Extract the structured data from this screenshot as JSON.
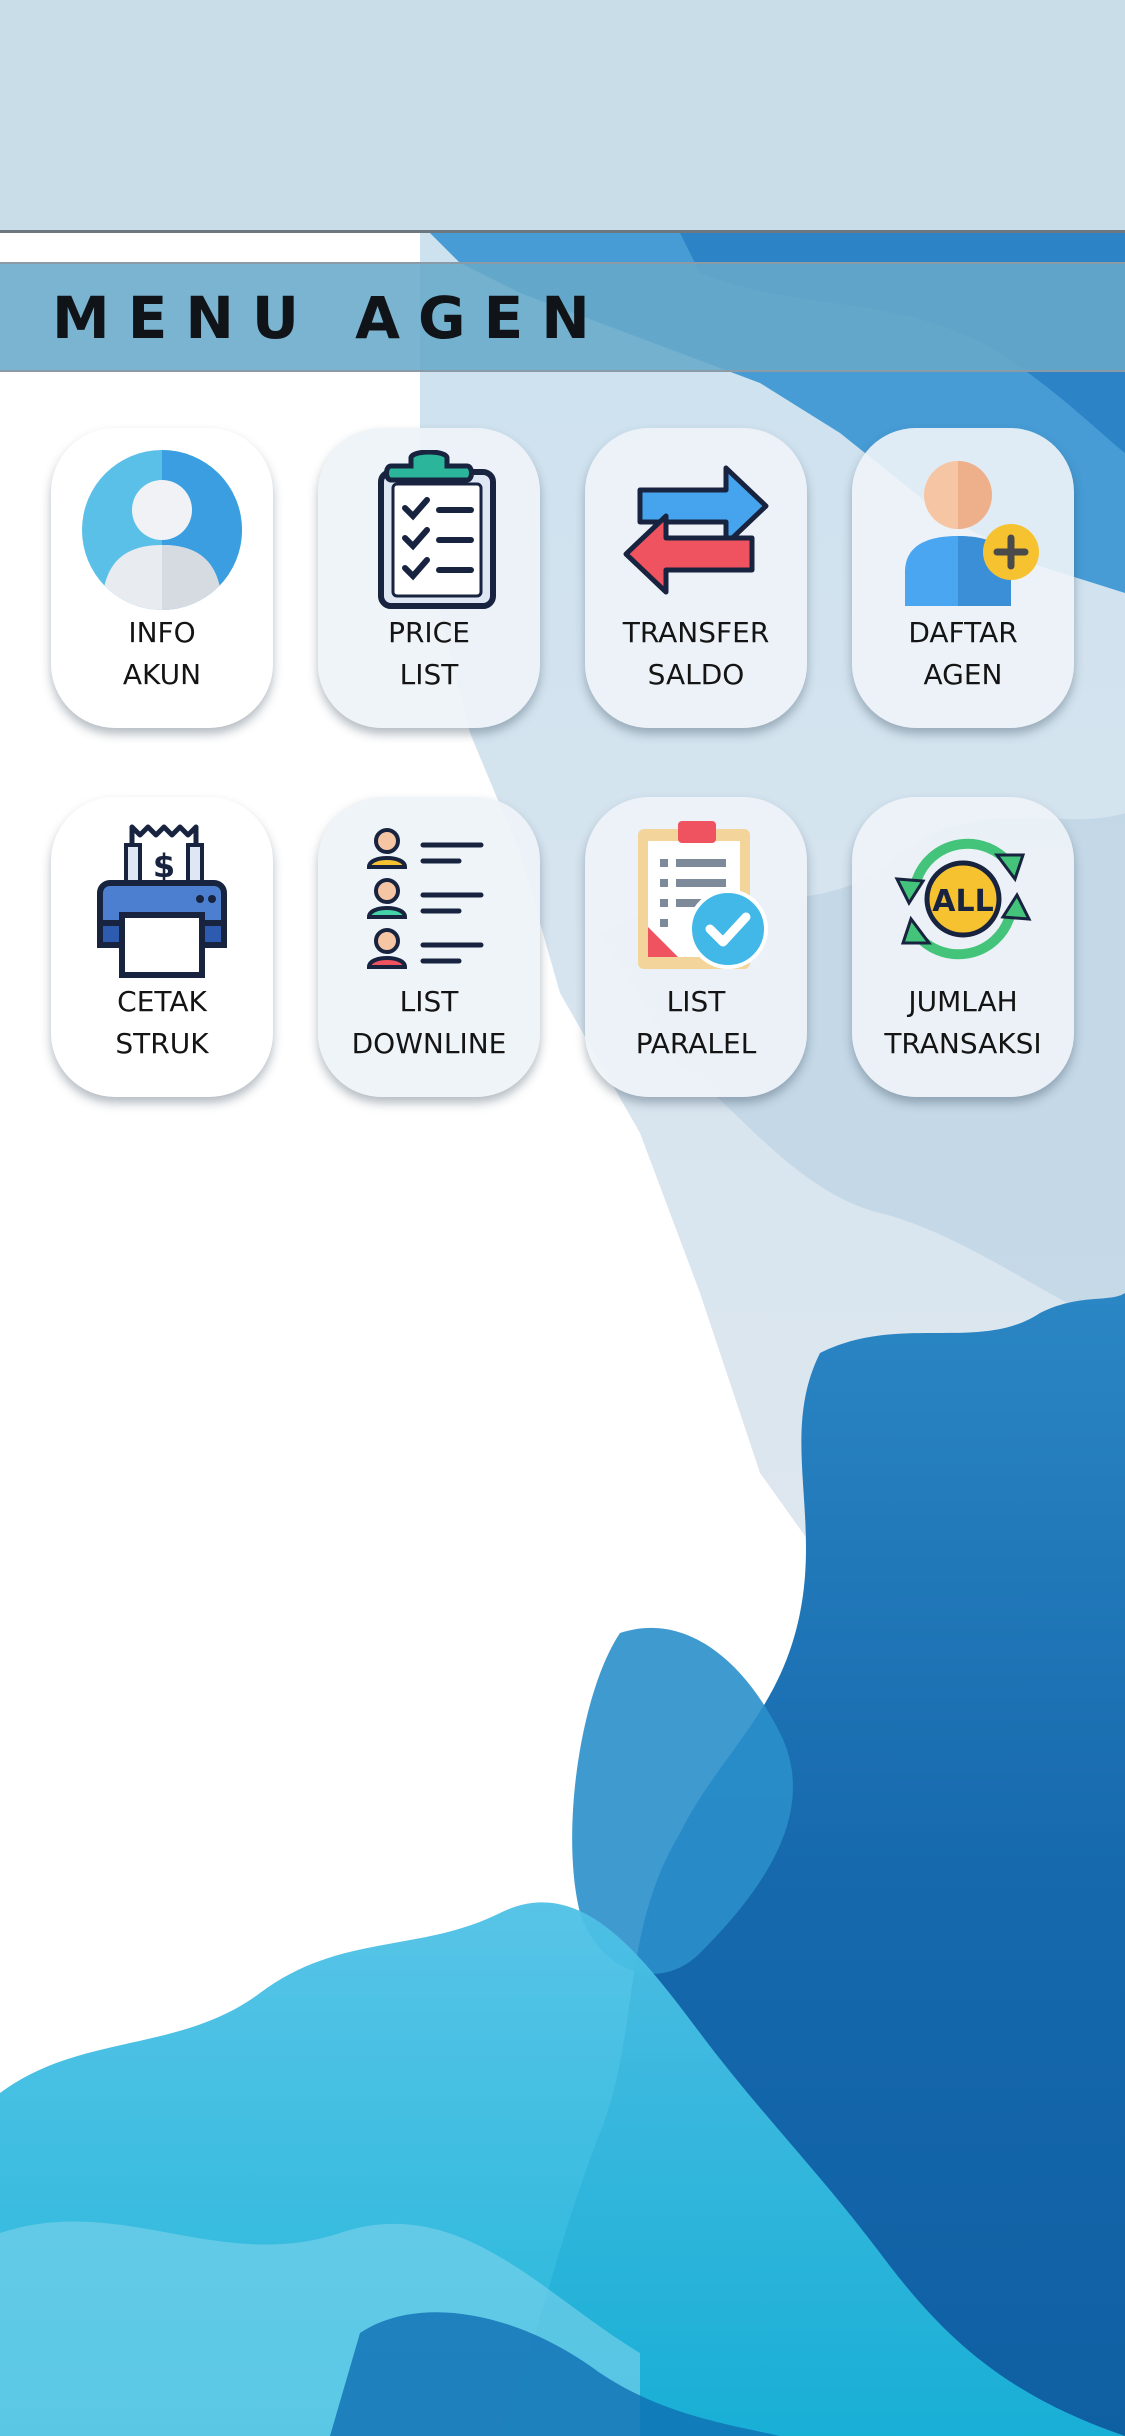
{
  "header": {
    "title": "MENU AGEN"
  },
  "menu": [
    {
      "line1": "INFO",
      "line2": "AKUN",
      "icon": "user-account-icon"
    },
    {
      "line1": "PRICE",
      "line2": "LIST",
      "icon": "clipboard-checklist-icon"
    },
    {
      "line1": "TRANSFER",
      "line2": "SALDO",
      "icon": "transfer-arrows-icon"
    },
    {
      "line1": "DAFTAR",
      "line2": "AGEN",
      "icon": "add-user-icon"
    },
    {
      "line1": "CETAK",
      "line2": "STRUK",
      "icon": "receipt-printer-icon"
    },
    {
      "line1": "LIST",
      "line2": "DOWNLINE",
      "icon": "people-list-icon"
    },
    {
      "line1": "LIST",
      "line2": "PARALEL",
      "icon": "checked-document-icon"
    },
    {
      "line1": "JUMLAH",
      "line2": "TRANSAKSI",
      "icon": "all-transactions-cycle-icon"
    }
  ],
  "colors": {
    "topbar": "#c9dde9",
    "title_bar": "#68aaca",
    "ink_blue": "#1a6fb0"
  }
}
